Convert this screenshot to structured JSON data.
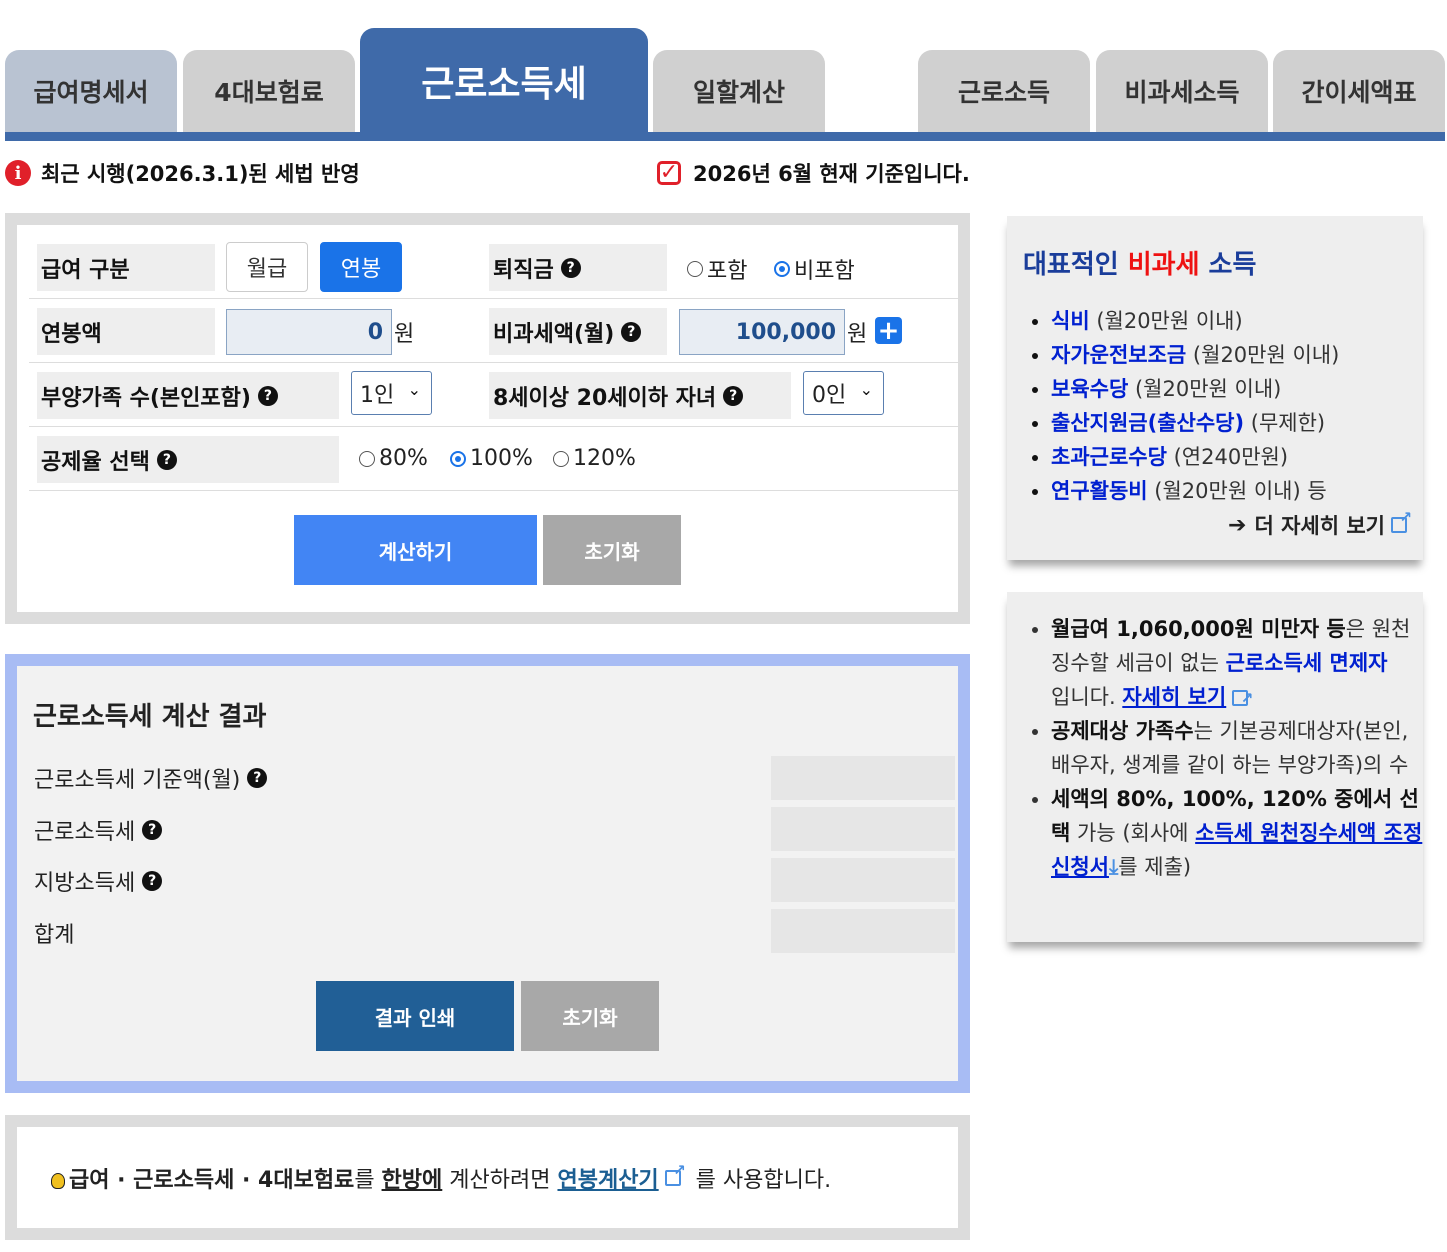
{
  "tabs": [
    {
      "label": "급여명세서"
    },
    {
      "label": "4대보험료"
    },
    {
      "label": "근로소득세"
    },
    {
      "label": "일할계산"
    },
    {
      "label": "근로소득"
    },
    {
      "label": "비과세소득"
    },
    {
      "label": "간이세액표"
    }
  ],
  "notices": {
    "law": "최근 시행(2026.3.1)된 세법 반영",
    "basis": "2026년 6월 현재 기준입니다."
  },
  "form": {
    "pay_type_label": "급여 구분",
    "pay_type_options": [
      "월급",
      "연봉"
    ],
    "pay_type_selected": "연봉",
    "severance_label": "퇴직금",
    "severance_options": [
      "포함",
      "비포함"
    ],
    "severance_selected": "비포함",
    "salary_label": "연봉액",
    "salary_value": "0",
    "salary_unit": "원",
    "nontax_label": "비과세액(월)",
    "nontax_value": "100,000",
    "nontax_unit": "원",
    "dependents_label": "부양가족 수(본인포함)",
    "dependents_value": "1인",
    "children_label": "8세이상 20세이하 자녀",
    "children_value": "0인",
    "rate_label": "공제율 선택",
    "rate_options": [
      "80%",
      "100%",
      "120%"
    ],
    "rate_selected": "100%",
    "calc_button": "계산하기",
    "reset_button": "초기화"
  },
  "result": {
    "title": "근로소득세 계산 결과",
    "rows": [
      {
        "label": "근로소득세 기준액(월)",
        "value": ""
      },
      {
        "label": "근로소득세",
        "value": ""
      },
      {
        "label": "지방소득세",
        "value": ""
      },
      {
        "label": "합계",
        "value": ""
      }
    ],
    "print_button": "결과 인쇄",
    "reset_button": "초기화"
  },
  "tip": {
    "t1": "급여 · 근로소득세 · 4대보험료",
    "t2": "를 ",
    "t3": "한방에",
    "t4": " 계산하려면 ",
    "link": "연봉계산기",
    "t5": " 를 사용합니다."
  },
  "side_nontax": {
    "title_a": "대표적인 ",
    "title_b": "비과세",
    "title_c": " 소득",
    "items": [
      {
        "name": "식비",
        "note": " (월20만원 이내)"
      },
      {
        "name": "자가운전보조금",
        "note": " (월20만원 이내)"
      },
      {
        "name": "보육수당",
        "note": " (월20만원 이내)"
      },
      {
        "name": "출산지원금(출산수당)",
        "note": " (무제한)"
      },
      {
        "name": "초과근로수당",
        "note": " (연240만원)"
      },
      {
        "name": "연구활동비",
        "note": " (월20만원 이내) 등"
      }
    ],
    "more": "더 자세히 보기"
  },
  "side_notes": {
    "n1_bold": "월급여 1,060,000원 미만자 등",
    "n1_text": "은 원천징수할 세금이 없는 ",
    "n1_link": "근로소득세 면제자",
    "n1_text2": "입니다. ",
    "n1_more": "자세히 보기",
    "n2_bold": "공제대상 가족수",
    "n2_text": "는 기본공제대상자(본인, 배우자, 생계를 같이 하는 부양가족)의 수",
    "n3_bold": "세액의 80%, 100%, 120% 중에서 선택",
    "n3_text": " 가능 (회사에 ",
    "n3_link": "소득세 원천징수세액 조정신청서",
    "n3_text2": "를 제출)"
  },
  "colors": {
    "tab_active": "#3f6aa9",
    "primary_button": "#4285f4",
    "print_button": "#215f96",
    "reset_button": "#a8a8a8",
    "result_border": "#a8bcf4",
    "alert_red": "#e0202a"
  }
}
